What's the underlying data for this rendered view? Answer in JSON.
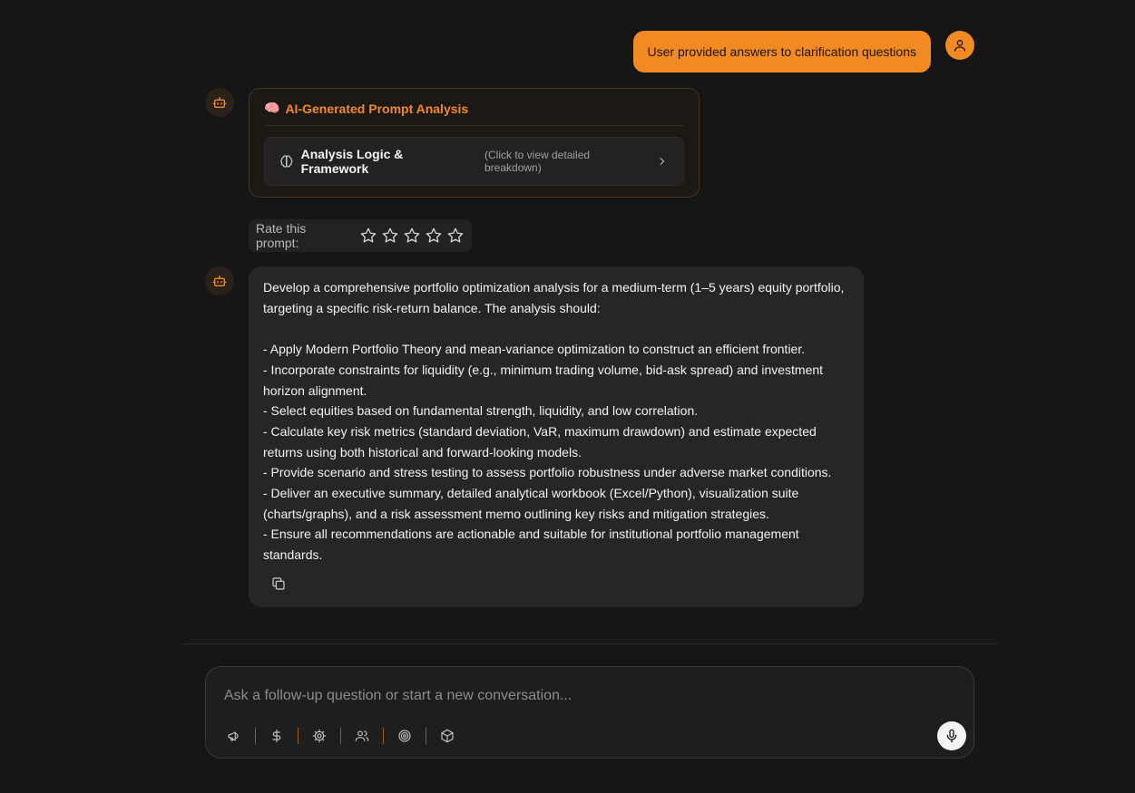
{
  "user_message": {
    "text": "User provided answers to clarification questions"
  },
  "analysis_card": {
    "emoji": "🧠",
    "title": "AI-Generated Prompt Analysis",
    "item_label": "Analysis Logic & Framework",
    "item_hint": "(Click to view detailed breakdown)"
  },
  "rating": {
    "label": "Rate this prompt:"
  },
  "response": {
    "text": "Develop a comprehensive portfolio optimization analysis for a medium-term (1–5 years) equity portfolio, targeting a specific risk-return balance. The analysis should:\n\n- Apply Modern Portfolio Theory and mean-variance optimization to construct an efficient frontier.\n- Incorporate constraints for liquidity (e.g., minimum trading volume, bid-ask spread) and investment horizon alignment.\n- Select equities based on fundamental strength, liquidity, and low correlation.\n- Calculate key risk metrics (standard deviation, VaR, maximum drawdown) and estimate expected returns using both historical and forward-looking models.\n- Provide scenario and stress testing to assess portfolio robustness under adverse market conditions.\n- Deliver an executive summary, detailed analytical workbook (Excel/Python), visualization suite (charts/graphs), and a risk assessment memo outlining key risks and mitigation strategies.\n- Ensure all recommendations are actionable and suitable for institutional portfolio management standards."
  },
  "composer": {
    "placeholder": "Ask a follow-up question or start a new conversation...",
    "tools": [
      "megaphone-icon",
      "dollar-icon",
      "gear-icon",
      "users-icon",
      "target-icon",
      "package-icon"
    ]
  },
  "colors": {
    "accent": "#f18a22",
    "background": "#161616",
    "bubble": "#262626"
  }
}
